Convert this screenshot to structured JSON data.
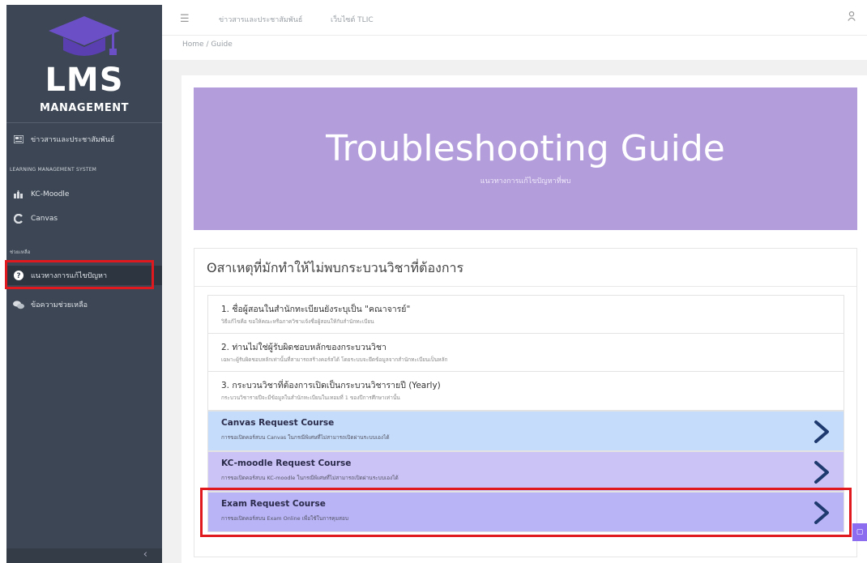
{
  "sidebar": {
    "logo_main": "LMS",
    "logo_sub": "MANAGEMENT",
    "news_label": "ข่าวสารและประชาสัมพันธ์",
    "section_lms": "LEARNING MANAGEMENT SYSTEM",
    "kc_moodle_label": "KC-Moodle",
    "canvas_label": "Canvas",
    "section_help": "ช่วยเหลือ",
    "troubleshoot_label": "แนวทางการแก้ไขปัญหา",
    "help_message_label": "ข้อความช่วยเหลือ",
    "collapse_glyph": "‹"
  },
  "topbar": {
    "menu_icon": "hamburger-icon",
    "link_news": "ข่าวสารและประชาสัมพันธ์",
    "link_tlic": "เว็บไซต์ TLIC",
    "user_icon": "user-icon"
  },
  "breadcrumb": "Home  /  Guide",
  "banner": {
    "title": "Troubleshooting Guide",
    "subtitle": "แนวทางการแก้ไขปัญหาที่พบ"
  },
  "panel": {
    "title": "ʘสาเหตุที่มักทำให้ไม่พบกระบวนวิชาที่ต้องการ",
    "items": [
      {
        "title": "1. ชื่อผู้สอนในสำนักทะเบียนยังระบุเป็น \"คณาจารย์\"",
        "desc": "วิธีแก้ไขคือ ขอให้คณะหรือภาควิชาแจ้งชื่อผู้สอนให้กับสำนักทะเบียน"
      },
      {
        "title": "2. ท่านไม่ใช่ผู้รับผิดชอบหลักของกระบวนวิชา",
        "desc": "เฉพาะผู้รับผิดชอบหลักเท่านั้นที่สามารถสร้างคอร์สได้ โดยระบบจะยึดข้อมูลจากสำนักทะเบียนเป็นหลัก"
      },
      {
        "title": "3. กระบวนวิชาที่ต้องการเปิดเป็นกระบวนวิชารายปี (Yearly)",
        "desc": "กระบวนวิชารายปีจะมีข้อมูลในสำนักทะเบียนในเทอมที่ 1 ของปีการศึกษาเท่านั้น"
      }
    ],
    "requests": [
      {
        "title": "Canvas Request Course",
        "desc": "การขอเปิดคอร์สบน Canvas ในกรณีพิเศษที่ไม่สามารถเปิดผ่านระบบเองได้",
        "color": "#c5dcfa"
      },
      {
        "title": "KC-moodle Request Course",
        "desc": "การขอเปิดคอร์สบน KC-moodle ในกรณีพิเศษที่ไม่สามารถเปิดผ่านระบบเองได้",
        "color": "#cbc3f5"
      },
      {
        "title": "Exam Request Course",
        "desc": "การขอเปิดคอร์สบน Exam Online เพื่อใช้ในการคุมสอบ",
        "color": "#b9b4f6"
      }
    ]
  },
  "colors": {
    "sidebar_bg": "#3c4654",
    "banner_bg": "#b39ddb",
    "highlight_red": "#e0191e",
    "chevron": "#1f3a6e"
  }
}
